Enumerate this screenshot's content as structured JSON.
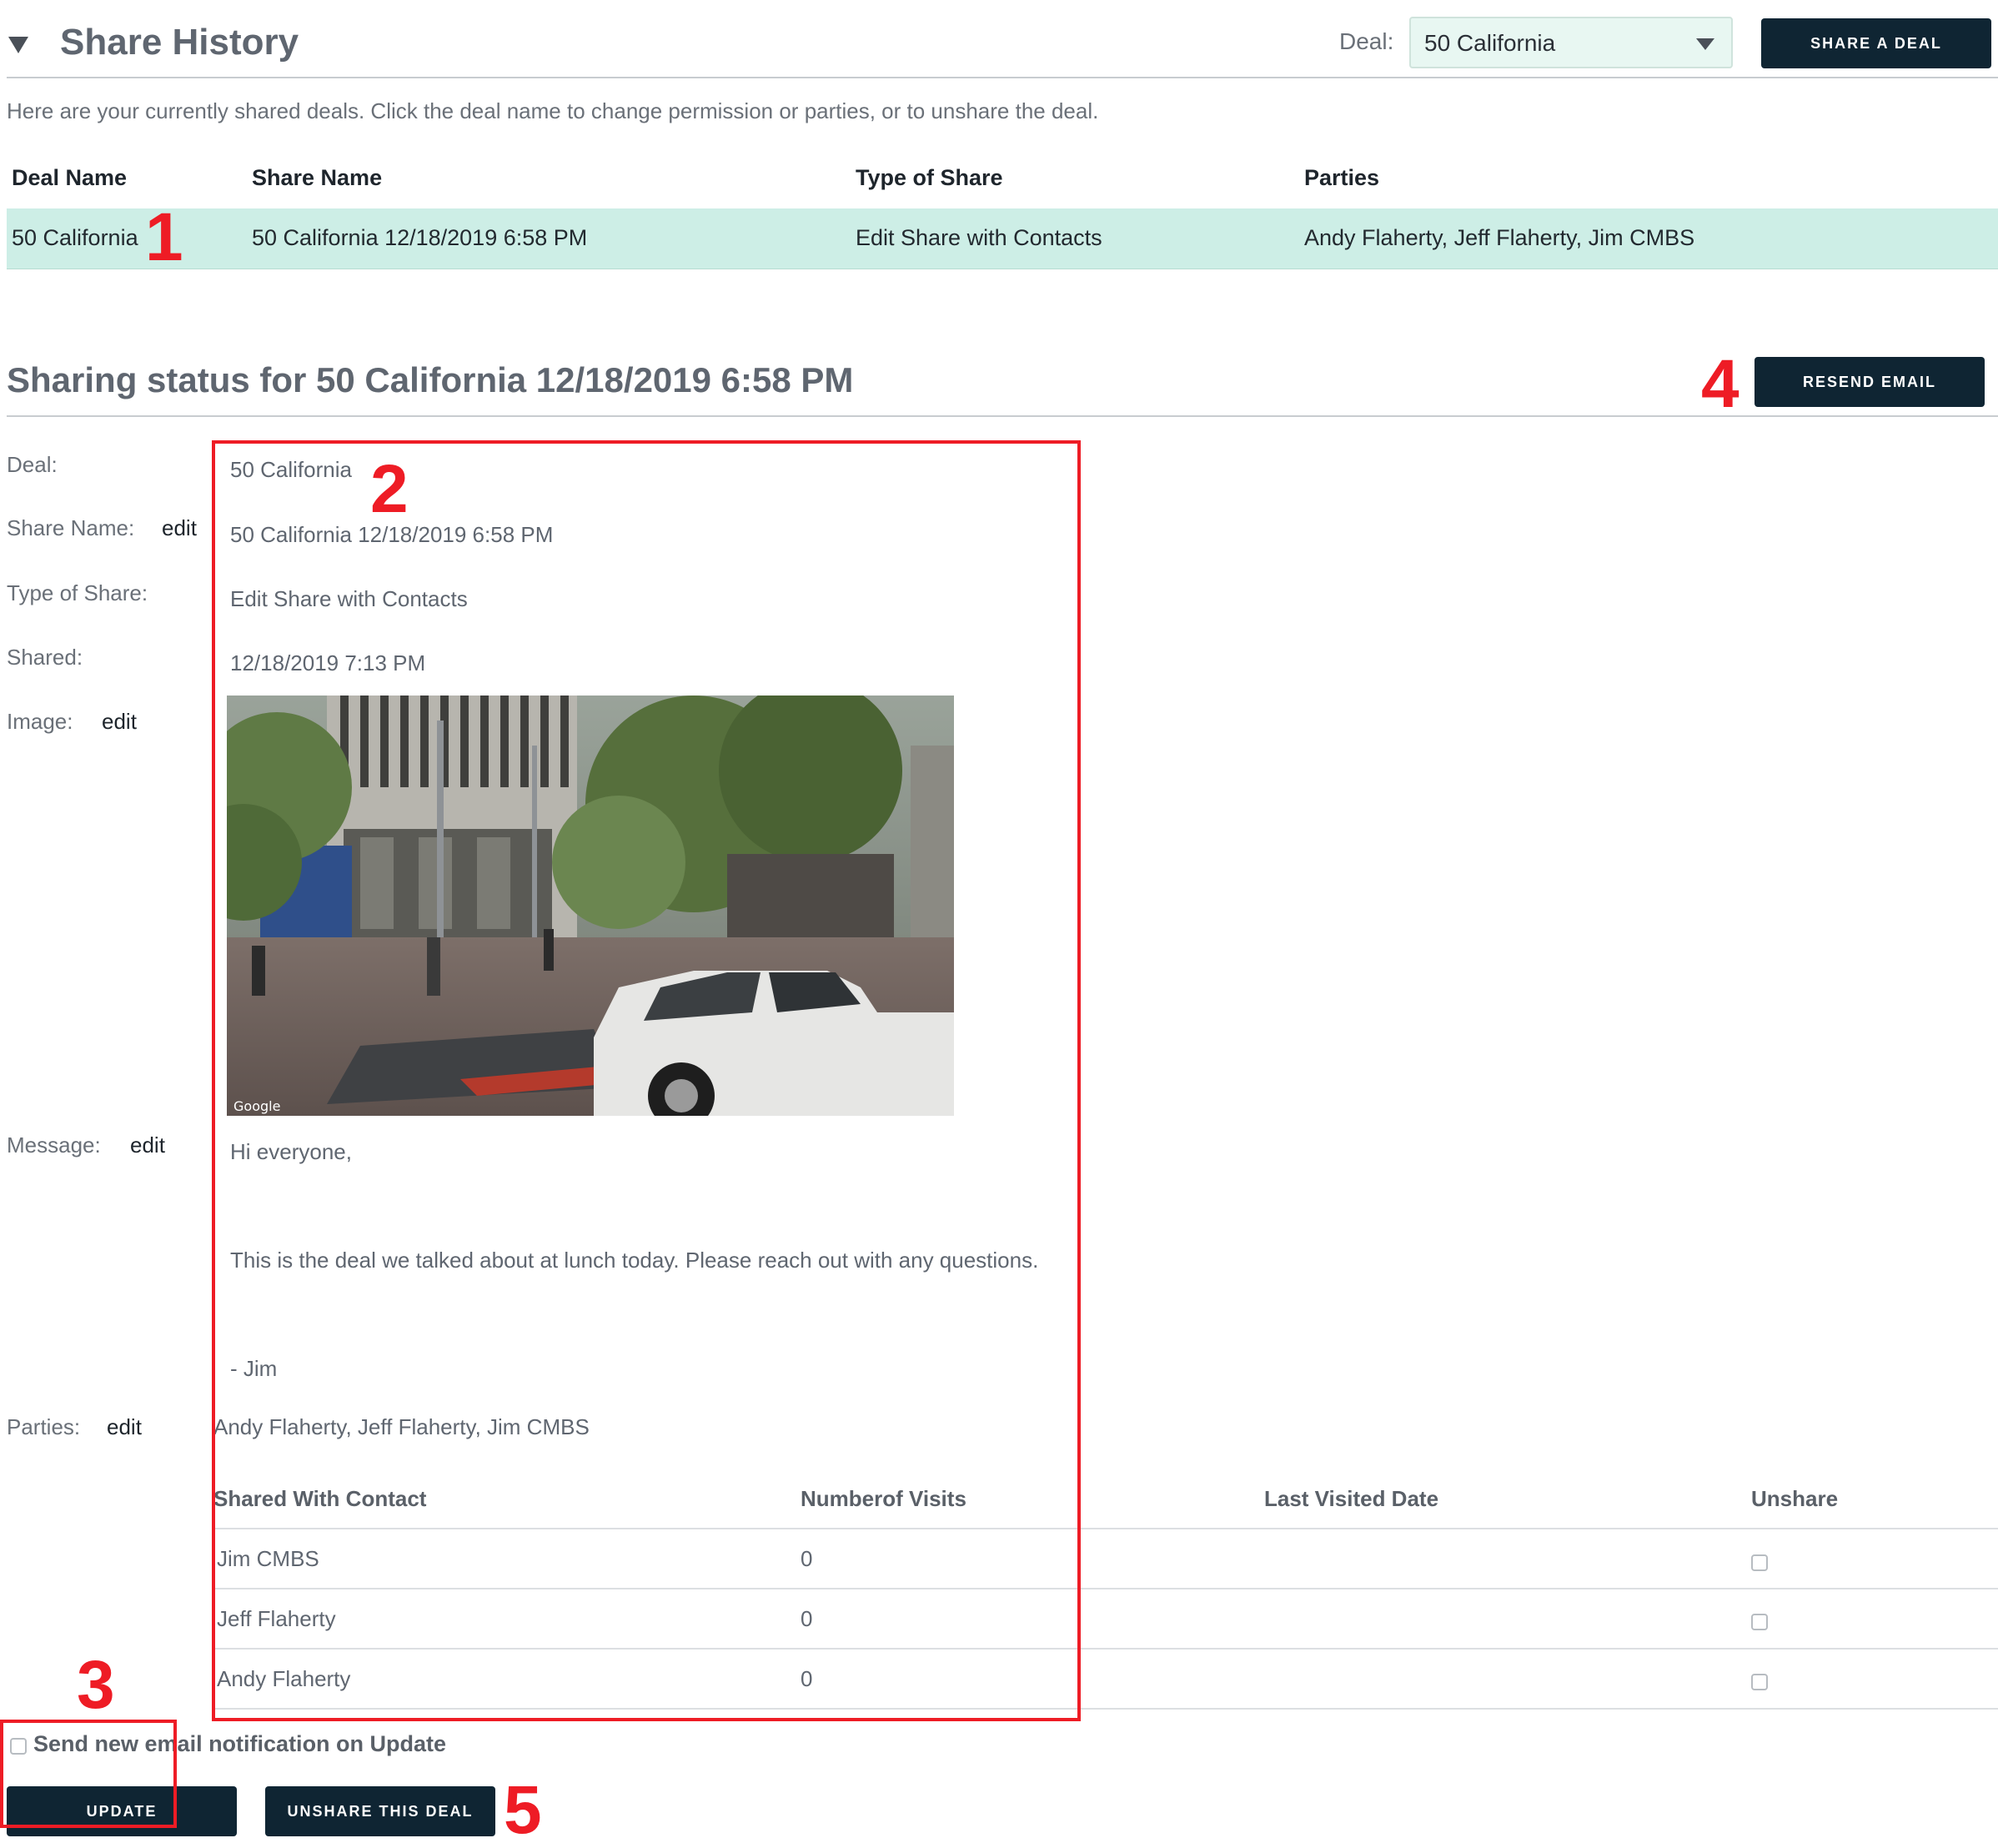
{
  "header": {
    "title": "Share History",
    "deal_label": "Deal:",
    "deal_selected": "50 California",
    "share_button": "SHARE A DEAL"
  },
  "intro_text": "Here are your currently shared deals. Click the deal name to change permission or parties, or to unshare the deal.",
  "shares_table": {
    "columns": [
      "Deal Name",
      "Share Name",
      "Type of Share",
      "Parties"
    ],
    "rows": [
      [
        "50 California",
        "50 California 12/18/2019 6:58 PM",
        "Edit Share with Contacts",
        "Andy Flaherty, Jeff Flaherty, Jim CMBS"
      ]
    ]
  },
  "status": {
    "title": "Sharing status for 50 California 12/18/2019 6:58 PM",
    "resend_button": "RESEND EMAIL",
    "labels": {
      "deal": "Deal:",
      "share_name": "Share Name:",
      "type": "Type of Share:",
      "shared": "Shared:",
      "image": "Image:",
      "message": "Message:",
      "parties": "Parties:"
    },
    "edit_label": "edit",
    "deal_value": "50 California",
    "share_name_value": "50 California 12/18/2019 6:58 PM",
    "type_value": "Edit Share with Contacts",
    "shared_value": "12/18/2019 7:13 PM",
    "image_watermark": "Google",
    "message_lines": [
      "Hi everyone,",
      "This is the deal we talked about at lunch today. Please reach out with any questions.",
      "- Jim"
    ],
    "parties_value": "Andy Flaherty, Jeff Flaherty, Jim CMBS"
  },
  "contacts_table": {
    "columns": [
      "Shared With Contact",
      "Numberof Visits",
      "Last Visited Date",
      "Unshare"
    ],
    "rows": [
      {
        "contact": "Jim CMBS",
        "visits": "0",
        "last_visited": "",
        "unshare": false
      },
      {
        "contact": "Jeff Flaherty",
        "visits": "0",
        "last_visited": "",
        "unshare": false
      },
      {
        "contact": "Andy Flaherty",
        "visits": "0",
        "last_visited": "",
        "unshare": false
      }
    ]
  },
  "footer": {
    "notify_label": "Send new email notification on Update",
    "notify_checked": false,
    "update_button": "UPDATE",
    "unshare_button": "UNSHARE THIS DEAL"
  },
  "annotations": [
    "1",
    "2",
    "3",
    "4",
    "5"
  ],
  "colors": {
    "accent_dark": "#0f2533",
    "row_highlight": "#cdeee6",
    "annotation_red": "#ee1c25"
  }
}
